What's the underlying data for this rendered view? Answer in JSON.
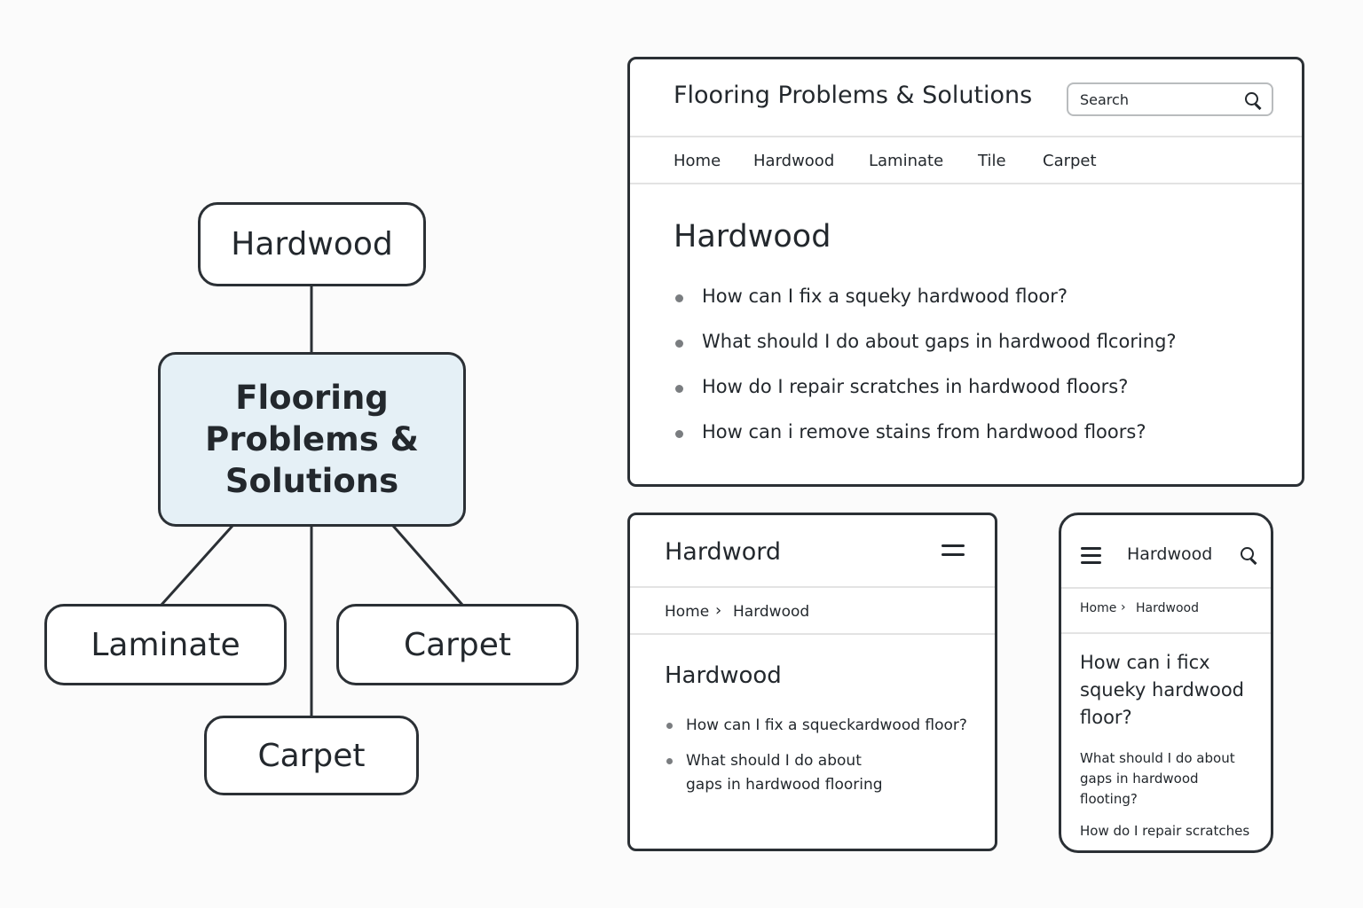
{
  "diagram": {
    "top_node": "Hardwood",
    "center_node": [
      "Flooring",
      "Problems &",
      "Solutions"
    ],
    "left_node": "Laminate",
    "right_node": "Carpet",
    "bottom_node": "Carpet",
    "center_fill": "#e5f0f6"
  },
  "desktop": {
    "title": "Flooring Problems & Solutions",
    "search_placeholder": "Search",
    "search_icon": "search-icon",
    "nav": [
      "Home",
      "Hardwood",
      "Laminate",
      "Tile",
      "Carpet"
    ],
    "heading": "Hardwood",
    "questions": [
      "How can I fix a squeky hardwood floor?",
      "What should I do about gaps in hardwood flcoring?",
      "How do I repair scratches in hardwood floors?",
      "How can i remove stains from hardwood floors?"
    ]
  },
  "tablet": {
    "title": "Hardword",
    "menu_icon": "menu-icon",
    "breadcrumb": [
      "Home",
      "Hardwood"
    ],
    "breadcrumb_separator": "›",
    "heading": "Hardwood",
    "questions": [
      "How can I fix a squeckardwood floor?",
      "What should I do about",
      "gaps in hardwood flooring"
    ]
  },
  "mobile": {
    "menu_icon": "menu-icon",
    "title": "Hardwood",
    "search_icon": "search-icon",
    "breadcrumb": [
      "Home",
      "Hardwood"
    ],
    "breadcrumb_separator": "›",
    "heading_lines": [
      "How can i ficx",
      "squeky hardwood",
      "floor?"
    ],
    "answer_lines": [
      "What should I do about",
      "gaps in hardwood",
      "flooting?"
    ],
    "next_question": "How do I repair scratches"
  }
}
